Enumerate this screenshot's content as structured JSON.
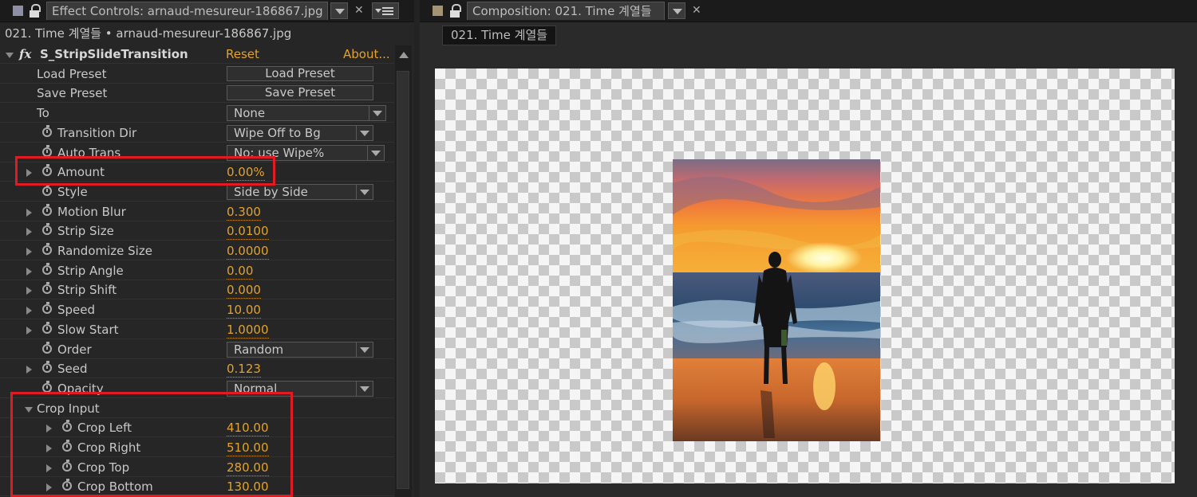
{
  "effect_controls": {
    "tab_title": "Effect Controls: arnaud-mesureur-186867.jpg",
    "subheader": "021. Time 계열들 • arnaud-mesureur-186867.jpg",
    "effect": {
      "name": "S_StripSlideTransition",
      "reset_label": "Reset",
      "about_label": "About..."
    },
    "buttons": {
      "load_preset": {
        "label": "Load Preset",
        "value": "Load Preset"
      },
      "save_preset": {
        "label": "Save Preset",
        "value": "Save Preset"
      }
    },
    "dropdowns": {
      "to": {
        "label": "To",
        "value": "None"
      },
      "transition_dir": {
        "label": "Transition Dir",
        "value": "Wipe Off to Bg"
      },
      "auto_trans": {
        "label": "Auto Trans",
        "value": "No: use Wipe%"
      },
      "style": {
        "label": "Style",
        "value": "Side by Side"
      },
      "order": {
        "label": "Order",
        "value": "Random"
      },
      "opacity": {
        "label": "Opacity",
        "value": "Normal"
      }
    },
    "params": {
      "amount": {
        "label": "Amount",
        "value": "0.00%"
      },
      "motion_blur": {
        "label": "Motion Blur",
        "value": "0.300"
      },
      "strip_size": {
        "label": "Strip Size",
        "value": "0.0100"
      },
      "randomize_size": {
        "label": "Randomize Size",
        "value": "0.0000"
      },
      "strip_angle": {
        "label": "Strip Angle",
        "value": "0.00"
      },
      "strip_shift": {
        "label": "Strip Shift",
        "value": "0.000"
      },
      "speed": {
        "label": "Speed",
        "value": "10.00"
      },
      "slow_start": {
        "label": "Slow Start",
        "value": "1.0000"
      },
      "seed": {
        "label": "Seed",
        "value": "0.123"
      }
    },
    "crop_input": {
      "label": "Crop Input",
      "crop_left": {
        "label": "Crop Left",
        "value": "410.00"
      },
      "crop_right": {
        "label": "Crop Right",
        "value": "510.00"
      },
      "crop_top": {
        "label": "Crop Top",
        "value": "280.00"
      },
      "crop_bottom": {
        "label": "Crop Bottom",
        "value": "130.00"
      }
    }
  },
  "composition": {
    "tab_title": "Composition: 021. Time 계열들",
    "comp_tab": "021. Time 계열들"
  },
  "colors": {
    "value_orange": "#e4a227",
    "highlight_red": "#e21a23",
    "panel_bg": "#262626"
  },
  "icons": [
    "lock-icon",
    "menu-icon",
    "close-icon",
    "stopwatch-icon",
    "fx-icon",
    "dropdown-icon"
  ]
}
